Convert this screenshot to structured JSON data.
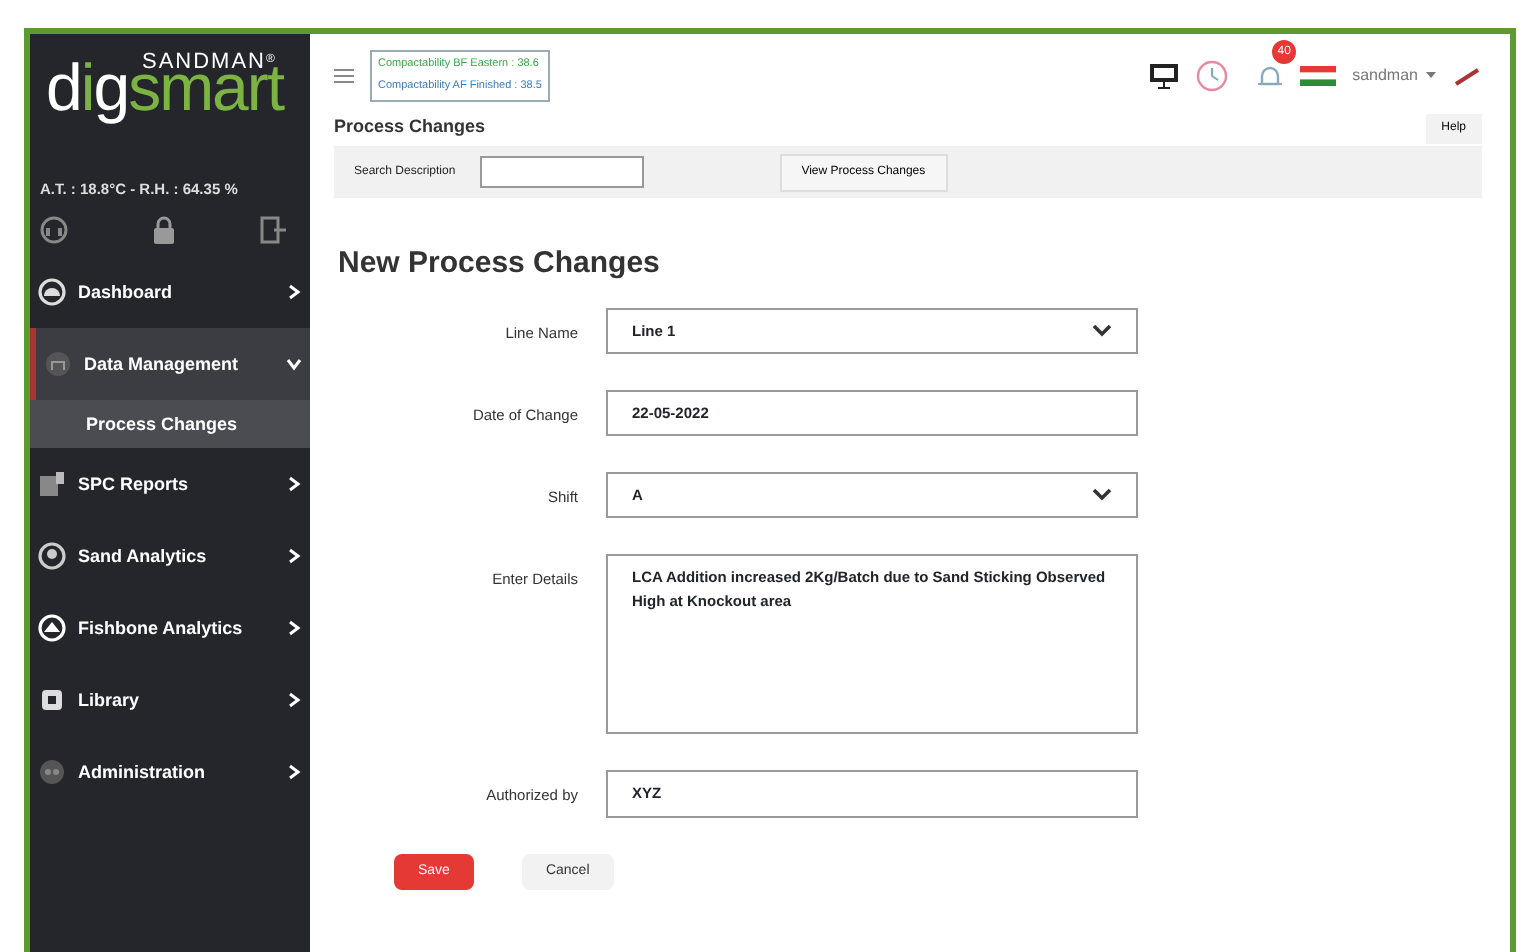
{
  "sidebar": {
    "logo": {
      "tagline": "SANDMAN",
      "registered": "®",
      "parts": [
        {
          "text": "d",
          "accent": false
        },
        {
          "text": "i",
          "accent": true
        },
        {
          "text": "g",
          "accent": false
        },
        {
          "text": "smart",
          "accent": true
        }
      ]
    },
    "climate": "A.T. : 18.8°C - R.H. : 64.35 %",
    "items": [
      {
        "label": "Dashboard",
        "expanded": false,
        "selected": false
      },
      {
        "label": "Data Management",
        "expanded": true,
        "selected": true,
        "children": [
          {
            "label": "Process Changes",
            "selected": true
          }
        ]
      },
      {
        "label": "SPC Reports",
        "expanded": false,
        "selected": false
      },
      {
        "label": "Sand Analytics",
        "expanded": false,
        "selected": false
      },
      {
        "label": "Fishbone Analytics",
        "expanded": false,
        "selected": false
      },
      {
        "label": "Library",
        "expanded": false,
        "selected": false
      },
      {
        "label": "Administration",
        "expanded": false,
        "selected": false
      }
    ]
  },
  "header": {
    "tickers": [
      {
        "text": "Compactability BF Eastern : 38.6",
        "color": "#3aa84a"
      },
      {
        "text": "Compactability AF Finished : 38.5",
        "color": "#3a7cc0"
      }
    ],
    "notification_count": "40",
    "user": "sandman",
    "help": "Help"
  },
  "page_title": "Process Changes",
  "search": {
    "label": "Search Description",
    "button": "View Process Changes"
  },
  "form": {
    "title": "New Process Changes",
    "fields": [
      {
        "label": "Line Name",
        "kind": "select",
        "value": "Line 1"
      },
      {
        "label": "Date of Change",
        "kind": "text",
        "value": "22-05-2022"
      },
      {
        "label": "Shift",
        "kind": "select",
        "value": "A"
      },
      {
        "label": "Enter Details",
        "kind": "textarea",
        "value": "LCA Addition increased 2Kg/Batch due to Sand Sticking Observed High at Knockout area"
      },
      {
        "label": "Authorized by",
        "kind": "text",
        "value": "XYZ"
      }
    ],
    "buttons": [
      {
        "label": "Save",
        "kind": "primary"
      },
      {
        "label": "Cancel",
        "kind": "secondary"
      }
    ]
  }
}
